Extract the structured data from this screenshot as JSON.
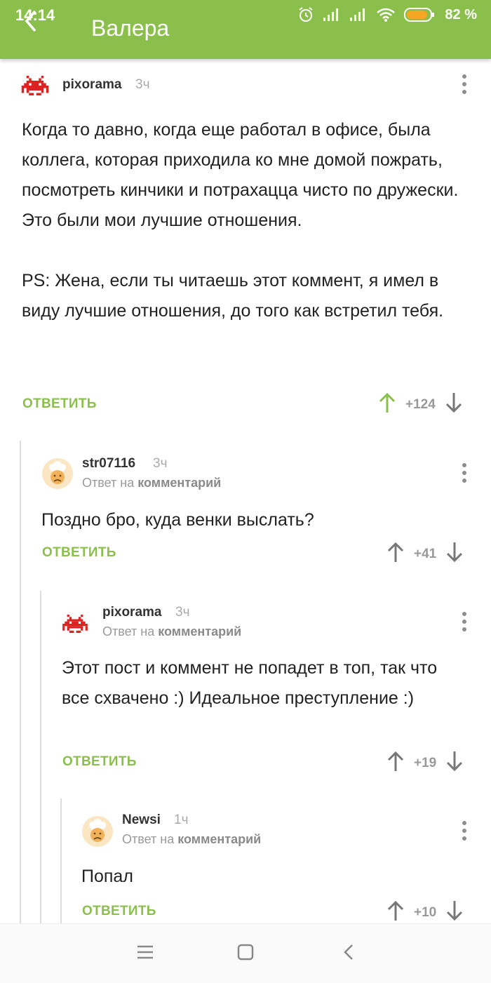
{
  "status_bar": {
    "time": "14:14",
    "battery": "82 %"
  },
  "app_bar": {
    "title": "Валера"
  },
  "reply_prefix": "Ответ на ",
  "reply_target": "комментарий",
  "reply_label": "ОТВЕТИТЬ",
  "comments": [
    {
      "username": "pixorama",
      "time": "3ч",
      "text": "Когда то давно, когда еще работал в офисе, была коллега, которая приходила ко мне домой пожрать, посмотреть кинчики и потрахацца чисто по дружески. Это были мои лучшие отношения.\n\nPS: Жена, если ты читаешь этот коммент, я имел в виду лучшие отношения, до того как встретил тебя.",
      "rating": "+124",
      "upvoted": true
    },
    {
      "username": "str07116",
      "time": "3ч",
      "text": "Поздно бро, куда венки выслать?",
      "rating": "+41",
      "upvoted": false
    },
    {
      "username": "pixorama",
      "time": "3ч",
      "text": "Этот пост и коммент не попадет в топ, так что все схвачено :) Идеальное преступление :)",
      "rating": "+19",
      "upvoted": false
    },
    {
      "username": "Newsi",
      "time": "1ч",
      "text": "Попал",
      "rating": "+10",
      "upvoted": false
    }
  ],
  "colors": {
    "accent": "#8bbf4c",
    "muted": "#999999",
    "text": "#222222"
  },
  "icons": [
    "back-arrow-icon",
    "alarm-icon",
    "signal-icon",
    "wifi-icon",
    "battery-icon",
    "space-invader-avatar",
    "chef-avatar",
    "more-vert-icon",
    "arrow-up-icon",
    "arrow-down-icon",
    "menu-icon",
    "home-square-icon",
    "back-chevron-icon"
  ]
}
